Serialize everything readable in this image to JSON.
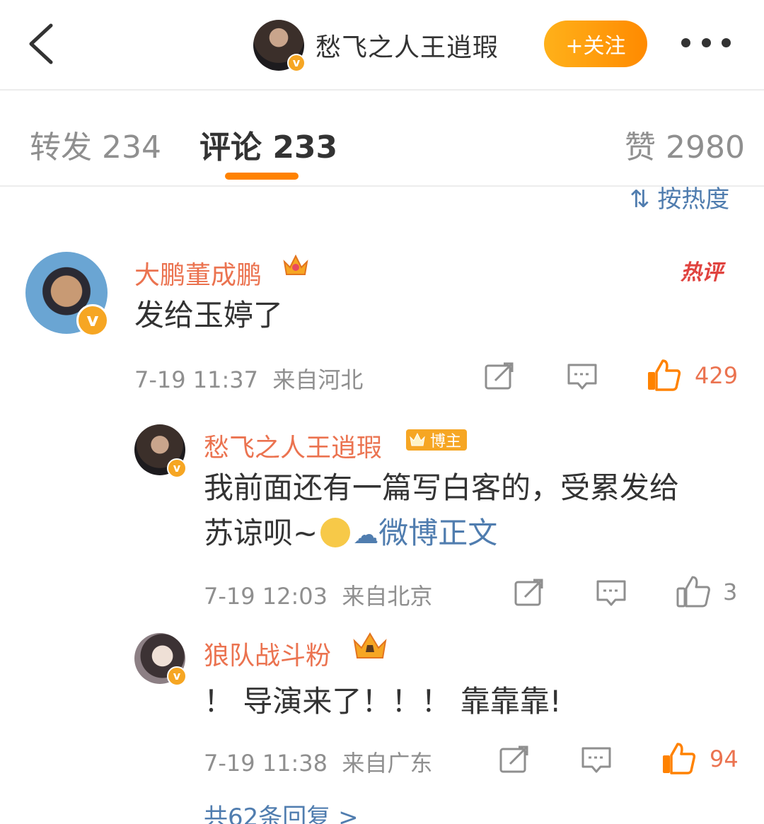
{
  "header": {
    "title": "愁飞之人王逍瑕",
    "follow_label": "+关注",
    "verified_mark": "v"
  },
  "tabs": [
    {
      "label": "转发 234"
    },
    {
      "label": "评论 233"
    },
    {
      "label": "赞 2980"
    }
  ],
  "sort_label": "按热度",
  "comments": [
    {
      "user": "大鹏董成鹏",
      "verified_mark": "v",
      "hot_label": "热评",
      "text": "发给玉婷了",
      "time": "7-19 11:37",
      "location": "来自河北",
      "likes": "429"
    },
    {
      "user": "愁飞之人王逍瑕",
      "badge": "博主",
      "verified_mark": "v",
      "text_line1": "我前面还有一篇写白客的，受累发给",
      "text_line2": "苏谅呗~",
      "link": "微博正文",
      "time": "7-19 12:03",
      "location": "来自北京",
      "likes": "3"
    },
    {
      "user": "狼队战斗粉",
      "verified_mark": "v",
      "text": "！ 导演来了！！！ 靠靠靠!",
      "time": "7-19 11:38",
      "location": "来自广东",
      "likes": "94"
    }
  ],
  "more_replies": "共62条回复 >",
  "colors": {
    "accent": "#ff8200",
    "username": "#eb7350",
    "link": "#507daf",
    "muted": "#8f8f8f",
    "verified": "#f6a623"
  },
  "icons": [
    "back-arrow-icon",
    "more-icon",
    "sort-icon",
    "crown-icon",
    "hot-comment-icon",
    "repost-icon",
    "comment-icon",
    "like-icon",
    "emoji-icon",
    "weibo-link-icon"
  ]
}
